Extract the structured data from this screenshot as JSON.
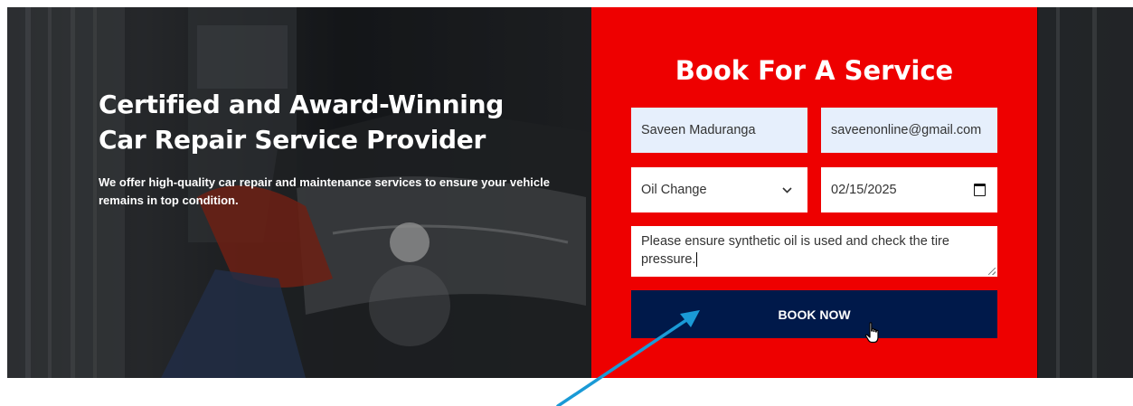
{
  "hero": {
    "title_line1": "Certified and Award-Winning",
    "title_line2": "Car Repair Service Provider",
    "subtitle": "We offer high-quality car repair and maintenance services to ensure your vehicle remains in top condition."
  },
  "booking": {
    "title": "Book For A Service",
    "name_value": "Saveen Maduranga",
    "email_value": "saveenonline@gmail.com",
    "service_value": "Oil Change",
    "date_value": "02/15/2025",
    "notes_value": "Please ensure synthetic oil is used and check the tire pressure.",
    "button_label": "BOOK NOW"
  },
  "colors": {
    "panel_red": "#ee0000",
    "button_navy": "#00194a",
    "input_highlight": "#e6effc",
    "annotation_arrow": "#1a9ad6"
  },
  "icons": {
    "select_chevron": "chevron-down-icon",
    "date_picker": "calendar-icon",
    "cursor": "hand-pointer-icon",
    "annotation": "arrow-icon"
  }
}
